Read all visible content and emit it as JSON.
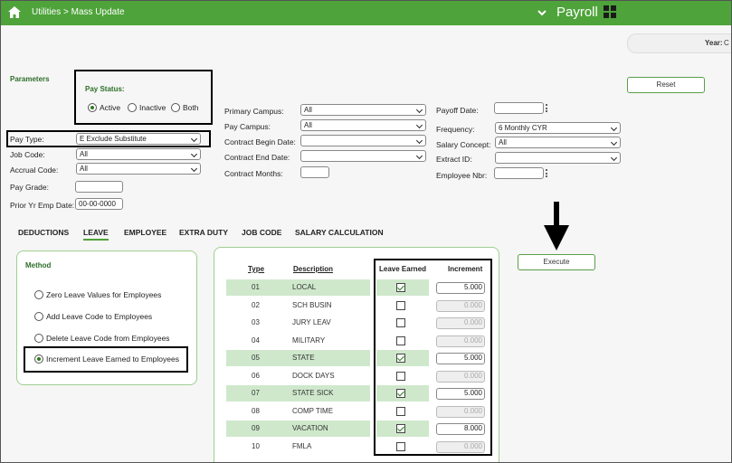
{
  "header": {
    "breadcrumb": "Utilities > Mass Update",
    "app_name": "Payroll",
    "year_label": "Year:",
    "year_value": "C"
  },
  "parameters": {
    "title": "Parameters",
    "pay_status": {
      "label": "Pay Status:",
      "options": [
        {
          "label": "Active",
          "selected": true
        },
        {
          "label": "Inactive",
          "selected": false
        },
        {
          "label": "Both",
          "selected": false
        }
      ]
    },
    "reset_label": "Reset",
    "left_fields": {
      "pay_type": {
        "label": "Pay Type:",
        "value": "E Exclude Substitute"
      },
      "job_code": {
        "label": "Job Code:",
        "value": "All"
      },
      "accrual_code": {
        "label": "Accrual Code:",
        "value": "All"
      },
      "pay_grade": {
        "label": "Pay Grade:",
        "value": ""
      },
      "prior_yr_emp_date": {
        "label": "Prior Yr Emp Date:",
        "value": "00-00-0000"
      }
    },
    "middle_fields": {
      "primary_campus": {
        "label": "Primary Campus:",
        "value": "All"
      },
      "pay_campus": {
        "label": "Pay Campus:",
        "value": "All"
      },
      "contract_begin_date": {
        "label": "Contract Begin Date:",
        "value": ""
      },
      "contract_end_date": {
        "label": "Contract End Date:",
        "value": ""
      },
      "contract_months": {
        "label": "Contract Months:",
        "value": ""
      }
    },
    "right_fields": {
      "payoff_date": {
        "label": "Payoff Date:",
        "value": ""
      },
      "frequency": {
        "label": "Frequency:",
        "value": "6 Monthly CYR"
      },
      "salary_concept": {
        "label": "Salary Concept:",
        "value": "All"
      },
      "extract_id": {
        "label": "Extract ID:",
        "value": ""
      },
      "employee_nbr": {
        "label": "Employee Nbr:",
        "value": ""
      }
    }
  },
  "tabs": [
    "DEDUCTIONS",
    "LEAVE",
    "EMPLOYEE",
    "EXTRA DUTY",
    "JOB CODE",
    "SALARY CALCULATION"
  ],
  "method": {
    "title": "Method",
    "options": [
      {
        "label": "Zero Leave Values for Employees",
        "selected": false
      },
      {
        "label": "Add Leave Code to Employees",
        "selected": false
      },
      {
        "label": "Delete Leave Code from Employees",
        "selected": false
      },
      {
        "label": "Increment Leave Earned to Employees",
        "selected": true
      }
    ]
  },
  "execute_label": "Execute",
  "leave_table": {
    "headers": {
      "type": "Type",
      "description": "Description",
      "leave_earned": "Leave Earned",
      "increment": "Increment"
    },
    "rows": [
      {
        "type": "01",
        "description": "LOCAL",
        "earned": true,
        "increment": "5.000"
      },
      {
        "type": "02",
        "description": "SCH BUSIN",
        "earned": false,
        "increment": "0.000"
      },
      {
        "type": "03",
        "description": "JURY LEAV",
        "earned": false,
        "increment": "0.000"
      },
      {
        "type": "04",
        "description": "MILITARY",
        "earned": false,
        "increment": "0.000"
      },
      {
        "type": "05",
        "description": "STATE",
        "earned": true,
        "increment": "5.000"
      },
      {
        "type": "06",
        "description": "DOCK DAYS",
        "earned": false,
        "increment": "0.000"
      },
      {
        "type": "07",
        "description": "STATE SICK",
        "earned": true,
        "increment": "5.000"
      },
      {
        "type": "08",
        "description": "COMP TIME",
        "earned": false,
        "increment": "0.000"
      },
      {
        "type": "09",
        "description": "VACATION",
        "earned": true,
        "increment": "8.000"
      },
      {
        "type": "10",
        "description": "FMLA",
        "earned": false,
        "increment": "0.000"
      }
    ]
  },
  "colors": {
    "accent": "#4ea33a",
    "row_highlight": "#cfe8cc"
  }
}
